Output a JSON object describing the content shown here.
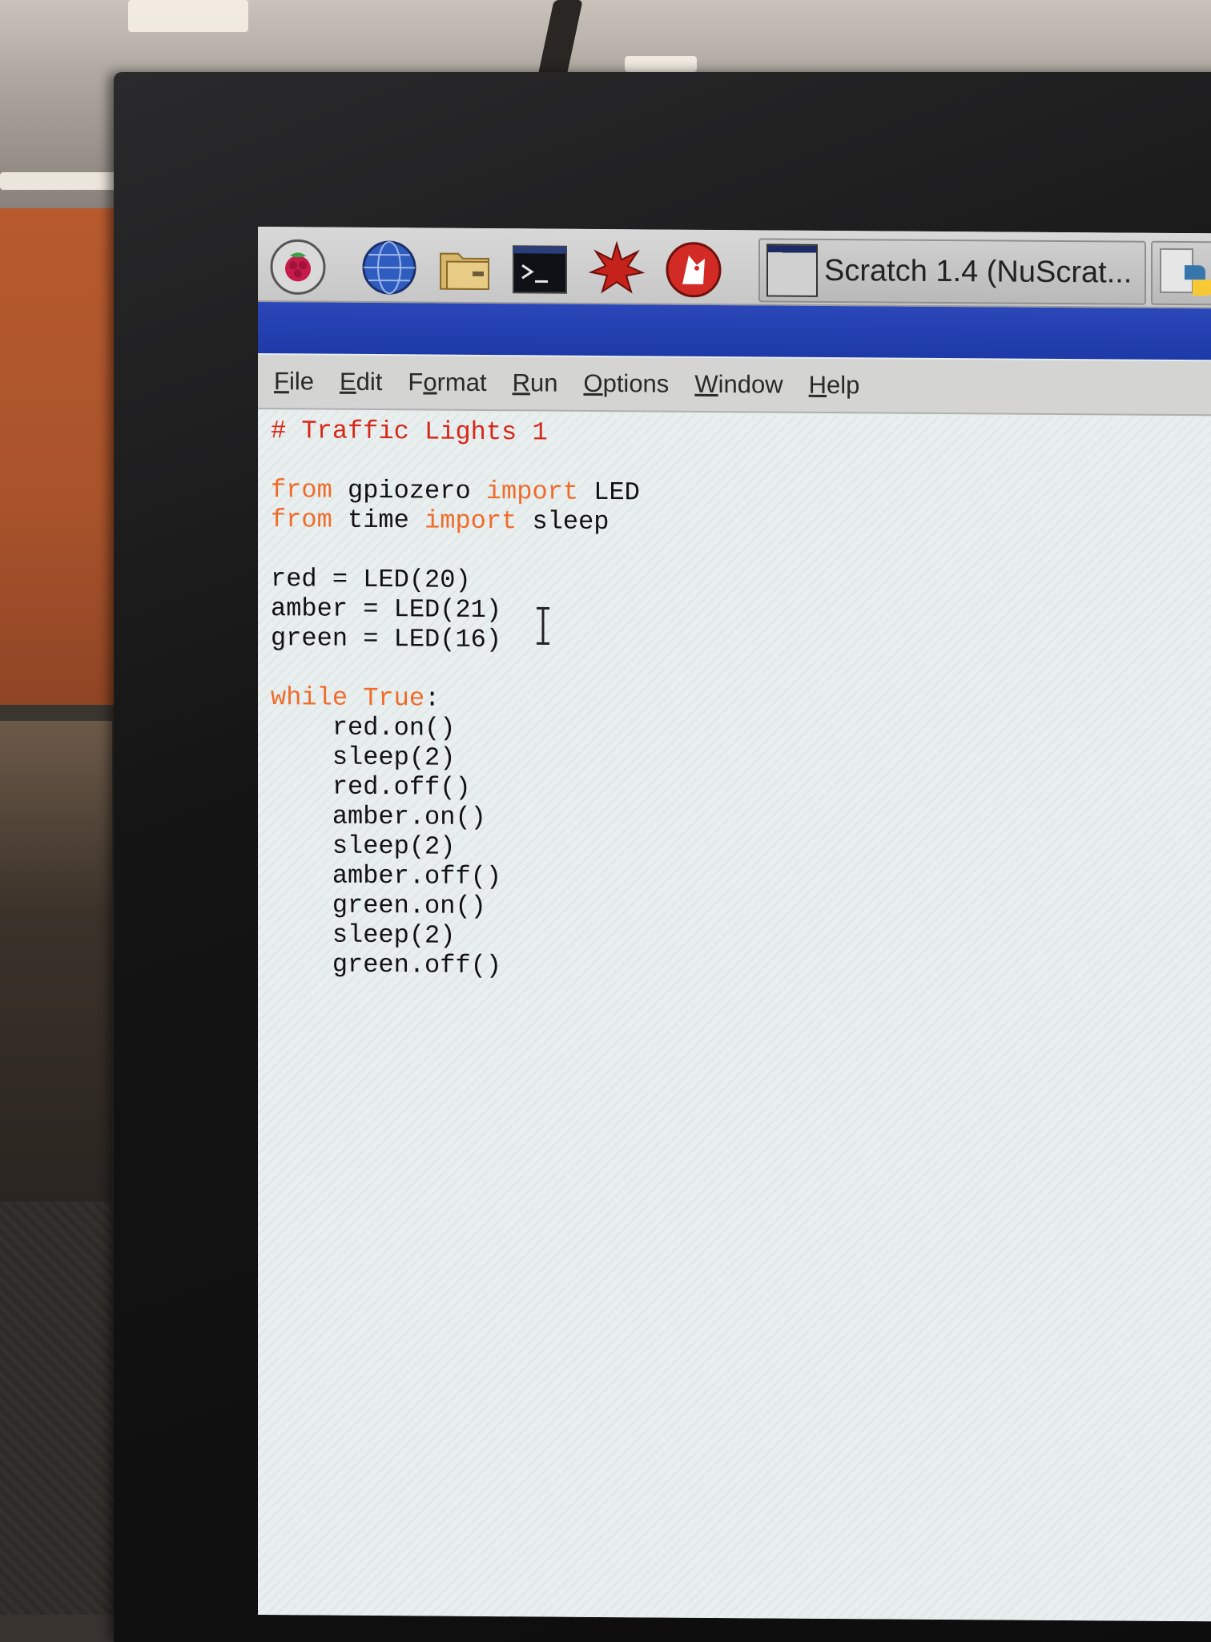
{
  "taskbar": {
    "launchers": [
      {
        "icon": "raspberry-menu-icon"
      },
      {
        "icon": "web-browser-icon"
      },
      {
        "icon": "file-manager-icon"
      },
      {
        "icon": "terminal-icon"
      },
      {
        "icon": "mathematica-icon"
      },
      {
        "icon": "wolfram-icon"
      }
    ],
    "active_task": {
      "label": "Scratch 1.4 (NuScrat..."
    },
    "second_task": {
      "icon": "python-icon"
    }
  },
  "menubar": {
    "items": [
      {
        "mnemonic": "F",
        "rest": "ile"
      },
      {
        "mnemonic": "E",
        "rest": "dit"
      },
      {
        "pre": "F",
        "mnemonic": "o",
        "rest": "rmat"
      },
      {
        "mnemonic": "R",
        "rest": "un"
      },
      {
        "mnemonic": "O",
        "rest": "ptions"
      },
      {
        "mnemonic": "W",
        "rest": "indow"
      },
      {
        "mnemonic": "H",
        "rest": "elp"
      }
    ]
  },
  "editor": {
    "lines": {
      "l1": {
        "comment": "# Traffic Lights 1"
      },
      "l3": {
        "kw1": "from",
        "t1": " gpiozero ",
        "kw2": "import",
        "t2": " LED"
      },
      "l4": {
        "kw1": "from",
        "t1": " time ",
        "kw2": "import",
        "t2": " sleep"
      },
      "l6": "red = LED(20)",
      "l7": "amber = LED(21)",
      "l8": "green = LED(16)",
      "l10": {
        "kw1": "while",
        "kw2": " True",
        "t": ":"
      },
      "l11": "    red.on()",
      "l12": "    sleep(2)",
      "l13": "    red.off()",
      "l14": "    amber.on()",
      "l15": "    sleep(2)",
      "l16": "    amber.off()",
      "l17": "    green.on()",
      "l18": "    sleep(2)",
      "l19": "    green.off()"
    }
  },
  "colors": {
    "comment": "#d6281a",
    "keyword": "#ef6b2a",
    "titlebar": "#1d3aa8",
    "text": "#111111"
  }
}
